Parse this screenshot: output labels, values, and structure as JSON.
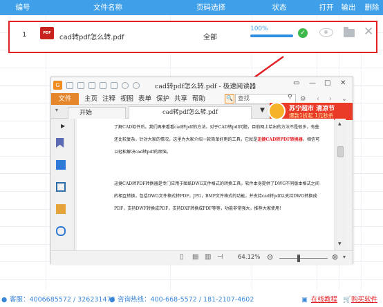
{
  "table": {
    "columns": [
      "编号",
      "文件名称",
      "页码选择",
      "状态",
      "打开",
      "输出",
      "删除"
    ],
    "row": {
      "index": "1",
      "filename": "cad转pdf怎么转.pdf",
      "pages": "全部",
      "progress_text": "100%",
      "progress_fraction": 1.0
    }
  },
  "icons": {
    "file_type": "pdf-file-icon",
    "status": "check-circle-icon",
    "open": "eye-icon",
    "output": "folder-icon",
    "delete": "close-icon"
  },
  "viewer": {
    "title": "cad转pdf怎么转.pdf - 极速阅读器",
    "menu": [
      "文件",
      "主页",
      "注释",
      "视图",
      "表单",
      "保护",
      "共享",
      "帮助"
    ],
    "search_placeholder": "查找",
    "tabs": [
      "开始",
      "cad转pdf怎么转.pdf"
    ],
    "ad_line1": "苏宁超市 清凉节",
    "ad_line2": "爆款1折起 1元秒杀",
    "zoom": "64.12%",
    "para1_a": "了解CAD软件后，我们再来看看cad转pdf的方法。对于CAD转pdf问题，目前网上给出的方法不是很多，有些还比较复杂，针对大家的情况，这里为大家介绍一款简单好用的工具，它就是",
    "para1_red": "迅捷CAD转PDF转换器",
    "para1_b": "，相信可以轻松解决cad转pdf的烦恼。",
    "para2": "迅捷CAD转PDF转换器是专门应用于图纸DWG文件格式的转换工具，软件本身提供了DWG不同版本格式之间的相互转换，包括DWG文件格式转PDF，JPG，BMP文件格式的功能，并支持cad转pdf以支持DWG转换成PDF，支持DWF转换成PDF，支持DXF转换成PDF等等，功能非常强大，推荐大家使用！"
  },
  "footer": {
    "qq": "客服：4006685572 / 326231478",
    "hotline": "咨询热线：400-668-5572 / 181-2107-4602",
    "tutorial": "在线教程",
    "buy": "购买软件"
  },
  "colors": {
    "header": "#3fa0e9",
    "highlight": "#e31f26",
    "accent": "#e6862b"
  }
}
